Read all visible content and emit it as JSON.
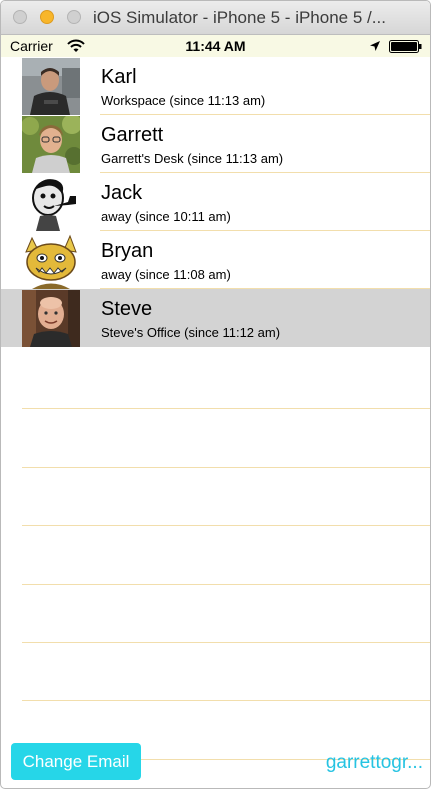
{
  "window": {
    "title": "iOS Simulator - iPhone 5 - iPhone 5 /..."
  },
  "status_bar": {
    "carrier": "Carrier",
    "time": "11:44 AM",
    "icons": [
      "wifi-icon",
      "location-arrow-icon",
      "battery-icon"
    ]
  },
  "people": [
    {
      "name": "Karl",
      "status": "Workspace (since 11:13 am)",
      "avatar": "karl-avatar",
      "selected": false
    },
    {
      "name": "Garrett",
      "status": "Garrett's Desk (since 11:13 am)",
      "avatar": "garrett-avatar",
      "selected": false
    },
    {
      "name": "Jack",
      "status": "away (since 10:11 am)",
      "avatar": "jack-avatar",
      "selected": false
    },
    {
      "name": "Bryan",
      "status": "away (since 11:08 am)",
      "avatar": "bryan-avatar",
      "selected": false
    },
    {
      "name": "Steve",
      "status": "Steve's Office (since 11:12 am)",
      "avatar": "steve-avatar",
      "selected": true
    }
  ],
  "footer": {
    "change_email_label": "Change Email",
    "email": "garrettogr..."
  },
  "colors": {
    "accent": "#26d6e8",
    "link": "#26c3e2",
    "separator": "#f2deac",
    "selected_row": "#d3d3d3",
    "status_bar_bg": "#f8f9e4"
  }
}
